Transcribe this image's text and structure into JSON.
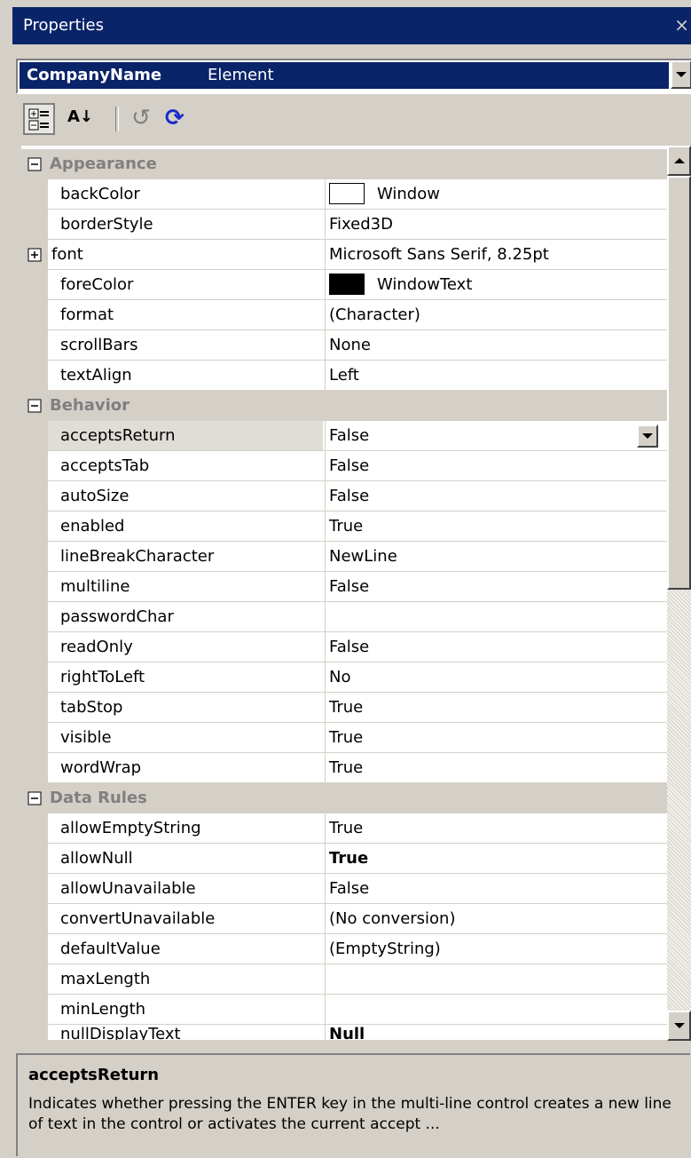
{
  "window": {
    "title": "Properties",
    "close_glyph": "×"
  },
  "object_selector": {
    "name": "CompanyName",
    "type": "Element"
  },
  "toolbar": {
    "icons": [
      "categorized-icon",
      "alphabetical-icon",
      "undo-icon",
      "refresh-icon"
    ],
    "alphabetical_glyph": "A↓",
    "undo_glyph": "↺",
    "refresh_glyph": "⟳"
  },
  "grid": {
    "categories": {
      "appearance": "Appearance",
      "behavior": "Behavior",
      "data_rules": "Data Rules"
    },
    "appearance": [
      {
        "name": "backColor",
        "value": "Window",
        "swatch": "#ffffff"
      },
      {
        "name": "borderStyle",
        "value": "Fixed3D"
      },
      {
        "name": "font",
        "value": "Microsoft Sans Serif, 8.25pt",
        "expandable": true
      },
      {
        "name": "foreColor",
        "value": "WindowText",
        "swatch": "#000000"
      },
      {
        "name": "format",
        "value": "(Character)"
      },
      {
        "name": "scrollBars",
        "value": "None"
      },
      {
        "name": "textAlign",
        "value": "Left"
      }
    ],
    "behavior": [
      {
        "name": "acceptsReturn",
        "value": "False",
        "selected": true
      },
      {
        "name": "acceptsTab",
        "value": "False"
      },
      {
        "name": "autoSize",
        "value": "False"
      },
      {
        "name": "enabled",
        "value": "True"
      },
      {
        "name": "lineBreakCharacter",
        "value": "NewLine"
      },
      {
        "name": "multiline",
        "value": "False"
      },
      {
        "name": "passwordChar",
        "value": ""
      },
      {
        "name": "readOnly",
        "value": "False"
      },
      {
        "name": "rightToLeft",
        "value": "No"
      },
      {
        "name": "tabStop",
        "value": "True"
      },
      {
        "name": "visible",
        "value": "True"
      },
      {
        "name": "wordWrap",
        "value": "True"
      }
    ],
    "data_rules": [
      {
        "name": "allowEmptyString",
        "value": "True"
      },
      {
        "name": "allowNull",
        "value": "True",
        "bold": true
      },
      {
        "name": "allowUnavailable",
        "value": "False"
      },
      {
        "name": "convertUnavailable",
        "value": "(No conversion)"
      },
      {
        "name": "defaultValue",
        "value": "(EmptyString)"
      },
      {
        "name": "maxLength",
        "value": ""
      },
      {
        "name": "minLength",
        "value": ""
      },
      {
        "name": "nullDisplayText",
        "value": "Null",
        "bold": true
      }
    ]
  },
  "description": {
    "title": "acceptsReturn",
    "text": "Indicates whether pressing the ENTER key in the multi-line control creates a new line of text in the control or activates the current accept ..."
  },
  "colors": {
    "titlebar": "#0a246a",
    "panel": "#d4d0c8",
    "category_text": "#808080"
  }
}
